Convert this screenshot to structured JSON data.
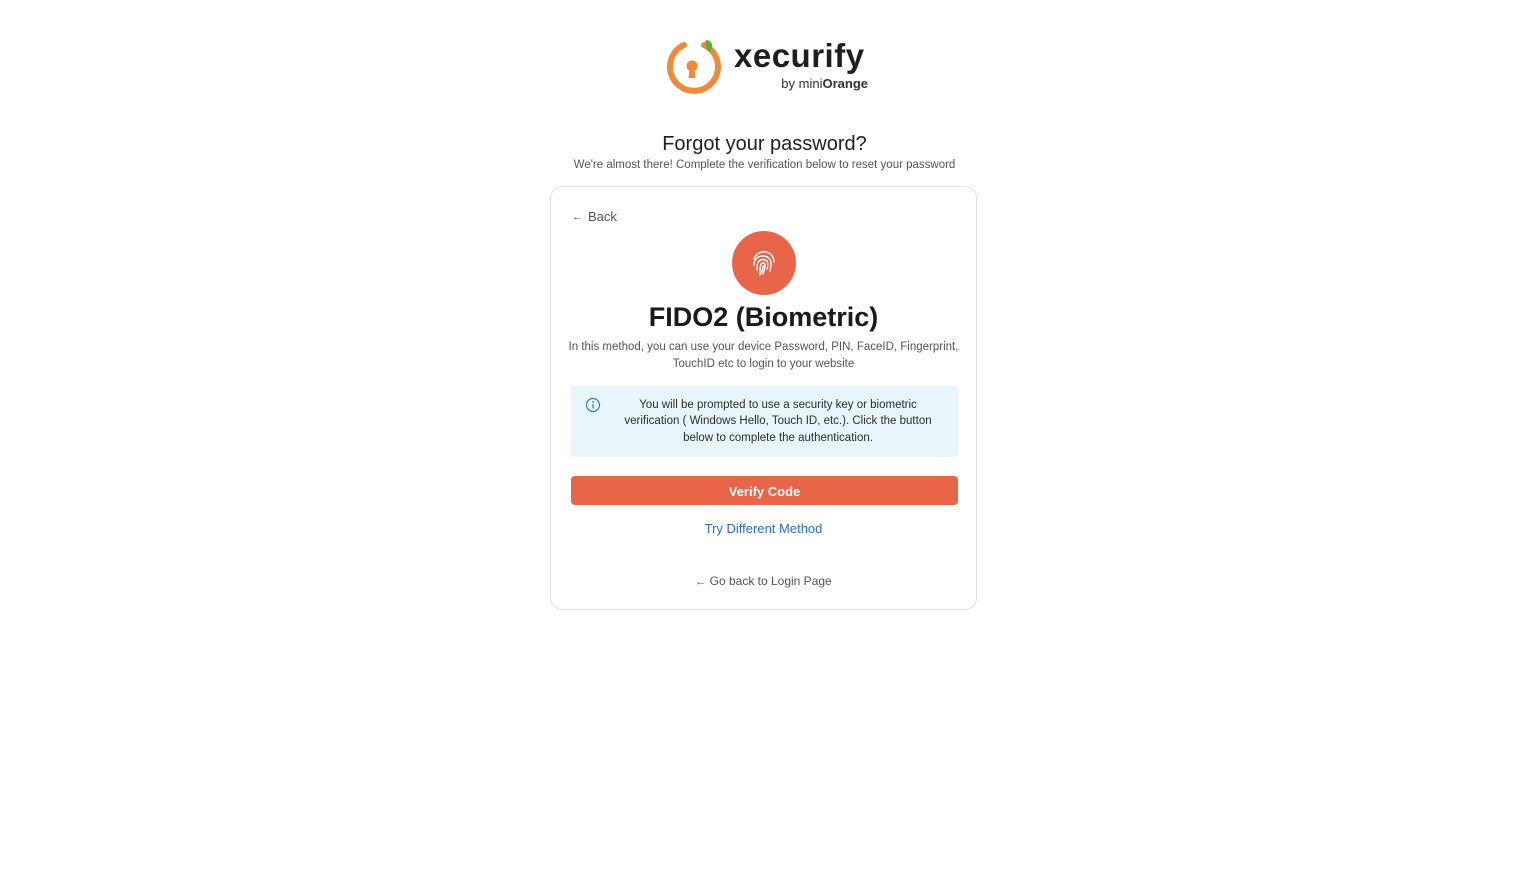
{
  "logo": {
    "wordmark": "xecurify",
    "by_text": "by mini",
    "brand_text": "Orange",
    "icon": "keyhole-logo-icon",
    "accent_color": "#f08a3a"
  },
  "header": {
    "title": "Forgot your password?",
    "subtitle": "We're almost there! Complete the verification below to reset your password"
  },
  "card": {
    "back_label": "Back",
    "back_icon": "arrow-left-icon",
    "method_icon": "fingerprint-icon",
    "method_title": "FIDO2 (Biometric)",
    "method_description": "In this method, you can use your device Password, PIN, FaceID, Fingerprint, TouchID etc to login to your website",
    "info": {
      "icon": "info-icon",
      "text": "You will be prompted to use a security key or biometric verification ( Windows Hello, Touch ID, etc.). Click the button below to complete the authentication."
    },
    "verify_button_label": "Verify Code",
    "try_different_label": "Try Different Method",
    "go_back_label": "Go back to Login Page"
  },
  "colors": {
    "primary": "#e9654a",
    "link": "#2a6fcf",
    "info_bg": "#e8f5fb"
  }
}
